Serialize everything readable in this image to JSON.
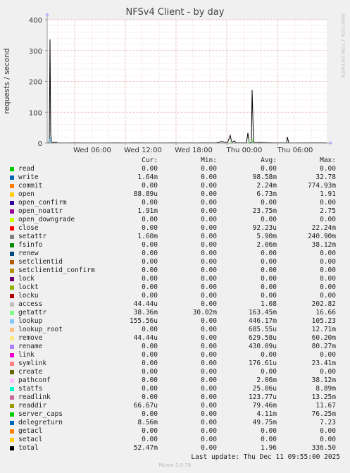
{
  "chart_data": {
    "type": "line",
    "title": "NFSv4 Client - by day",
    "ylabel": "requests / second",
    "ylim": [
      0,
      400
    ],
    "y_ticks": [
      "0",
      "100",
      "200",
      "300",
      "400"
    ],
    "x_ticks": [
      "Wed 06:00",
      "Wed 12:00",
      "Wed 18:00",
      "Thu 00:00",
      "Thu 06:00"
    ],
    "grid": true,
    "series": [
      {
        "name": "total",
        "color": "#000000",
        "points": [
          [
            0,
            0
          ],
          [
            3,
            3
          ],
          [
            4,
            336
          ],
          [
            5,
            30
          ],
          [
            6,
            2
          ],
          [
            12,
            3
          ],
          [
            15,
            1
          ],
          [
            25,
            0.5
          ],
          [
            40,
            1
          ],
          [
            55,
            0.8
          ],
          [
            60,
            0.5
          ],
          [
            80,
            0.4
          ],
          [
            100,
            1
          ],
          [
            110,
            0.6
          ],
          [
            118,
            0.4
          ],
          [
            119,
            1
          ],
          [
            130,
            1
          ],
          [
            145,
            0.6
          ],
          [
            165,
            0.6
          ],
          [
            178,
            1
          ],
          [
            190,
            0.5
          ],
          [
            205,
            1
          ],
          [
            210,
            0.8
          ],
          [
            220,
            1
          ],
          [
            240,
            1
          ],
          [
            248,
            5
          ],
          [
            256,
            1
          ],
          [
            260,
            25
          ],
          [
            262,
            2
          ],
          [
            266,
            7
          ],
          [
            268,
            1
          ],
          [
            283,
            1
          ],
          [
            285,
            33
          ],
          [
            287,
            1
          ],
          [
            290,
            3
          ],
          [
            291,
            172
          ],
          [
            293,
            5
          ],
          [
            295,
            1
          ],
          [
            300,
            2
          ],
          [
            320,
            1
          ],
          [
            340,
            1
          ],
          [
            341,
            20
          ],
          [
            343,
            1
          ],
          [
            350,
            0.5
          ],
          [
            370,
            1
          ],
          [
            396,
            1
          ],
          [
            397,
            0
          ]
        ]
      },
      {
        "name": "getattr",
        "color": "#98FB98",
        "points": [
          [
            0,
            0
          ],
          [
            3,
            0
          ],
          [
            4,
            12
          ],
          [
            6,
            0
          ],
          [
            260,
            0
          ],
          [
            261,
            6
          ],
          [
            262,
            0
          ],
          [
            285,
            0
          ],
          [
            286,
            8
          ],
          [
            287,
            0
          ],
          [
            290,
            0
          ],
          [
            291,
            15
          ],
          [
            293,
            0
          ],
          [
            340,
            0
          ],
          [
            341,
            3
          ],
          [
            343,
            0
          ],
          [
            397,
            0
          ]
        ]
      },
      {
        "name": "readdir",
        "color": "#8B9A0A",
        "points": [
          [
            0,
            0
          ],
          [
            3,
            0
          ],
          [
            4,
            11
          ],
          [
            6,
            0
          ],
          [
            290,
            0
          ],
          [
            291,
            6
          ],
          [
            293,
            0
          ],
          [
            397,
            0
          ]
        ]
      },
      {
        "name": "lookup",
        "color": "#7EC8FF",
        "points": [
          [
            0,
            0
          ],
          [
            3,
            0
          ],
          [
            4,
            20
          ],
          [
            5,
            0
          ],
          [
            290,
            0
          ],
          [
            291,
            4
          ],
          [
            292,
            0
          ],
          [
            397,
            0
          ]
        ]
      }
    ]
  },
  "legend": {
    "headers": {
      "cur": "Cur:",
      "min": "Min:",
      "avg": "Avg:",
      "max": "Max:"
    },
    "rows": [
      {
        "name": "read",
        "color": "#00CC00",
        "cur": "0.00",
        "min": "0.00",
        "avg": "0.00",
        "max": "0.00"
      },
      {
        "name": "write",
        "color": "#0066B3",
        "cur": "1.64m",
        "min": "0.00",
        "avg": "98.58m",
        "max": "32.78"
      },
      {
        "name": "commit",
        "color": "#FF8000",
        "cur": "0.00",
        "min": "0.00",
        "avg": "2.24m",
        "max": "774.93m"
      },
      {
        "name": "open",
        "color": "#FFCC00",
        "cur": "88.89u",
        "min": "0.00",
        "avg": "6.73m",
        "max": "1.91"
      },
      {
        "name": "open_confirm",
        "color": "#330099",
        "cur": "0.00",
        "min": "0.00",
        "avg": "0.00",
        "max": "0.00"
      },
      {
        "name": "open_noattr",
        "color": "#990099",
        "cur": "1.91m",
        "min": "0.00",
        "avg": "23.75m",
        "max": "2.75"
      },
      {
        "name": "open_downgrade",
        "color": "#CCFF00",
        "cur": "0.00",
        "min": "0.00",
        "avg": "0.00",
        "max": "0.00"
      },
      {
        "name": "close",
        "color": "#FF0000",
        "cur": "0.00",
        "min": "0.00",
        "avg": "92.23u",
        "max": "22.24m"
      },
      {
        "name": "setattr",
        "color": "#808080",
        "cur": "1.60m",
        "min": "0.00",
        "avg": "5.90m",
        "max": "240.90m"
      },
      {
        "name": "fsinfo",
        "color": "#008F00",
        "cur": "0.00",
        "min": "0.00",
        "avg": "2.06m",
        "max": "38.12m"
      },
      {
        "name": "renew",
        "color": "#00487D",
        "cur": "0.00",
        "min": "0.00",
        "avg": "0.00",
        "max": "0.00"
      },
      {
        "name": "setclientid",
        "color": "#B35A00",
        "cur": "0.00",
        "min": "0.00",
        "avg": "0.00",
        "max": "0.00"
      },
      {
        "name": "setclientid_confirm",
        "color": "#B38F00",
        "cur": "0.00",
        "min": "0.00",
        "avg": "0.00",
        "max": "0.00"
      },
      {
        "name": "lock",
        "color": "#6B006B",
        "cur": "0.00",
        "min": "0.00",
        "avg": "0.00",
        "max": "0.00"
      },
      {
        "name": "lockt",
        "color": "#8FB300",
        "cur": "0.00",
        "min": "0.00",
        "avg": "0.00",
        "max": "0.00"
      },
      {
        "name": "locku",
        "color": "#B30000",
        "cur": "0.00",
        "min": "0.00",
        "avg": "0.00",
        "max": "0.00"
      },
      {
        "name": "access",
        "color": "#BEBEBE",
        "cur": "44.44u",
        "min": "0.00",
        "avg": "1.08",
        "max": "202.82"
      },
      {
        "name": "getattr",
        "color": "#80FF80",
        "cur": "38.36m",
        "min": "30.02m",
        "avg": "163.45m",
        "max": "16.66"
      },
      {
        "name": "lookup",
        "color": "#80C9FF",
        "cur": "155.56u",
        "min": "0.00",
        "avg": "446.17m",
        "max": "105.23"
      },
      {
        "name": "lookup_root",
        "color": "#FFC080",
        "cur": "0.00",
        "min": "0.00",
        "avg": "685.55u",
        "max": "12.71m"
      },
      {
        "name": "remove",
        "color": "#FFE680",
        "cur": "44.44u",
        "min": "0.00",
        "avg": "629.58u",
        "max": "60.20m"
      },
      {
        "name": "rename",
        "color": "#AA80FF",
        "cur": "0.00",
        "min": "0.00",
        "avg": "430.09u",
        "max": "80.27m"
      },
      {
        "name": "link",
        "color": "#EE00CC",
        "cur": "0.00",
        "min": "0.00",
        "avg": "0.00",
        "max": "0.00"
      },
      {
        "name": "symlink",
        "color": "#FF8080",
        "cur": "0.00",
        "min": "0.00",
        "avg": "176.61u",
        "max": "23.41m"
      },
      {
        "name": "create",
        "color": "#666600",
        "cur": "0.00",
        "min": "0.00",
        "avg": "0.00",
        "max": "0.00"
      },
      {
        "name": "pathconf",
        "color": "#FFBFFF",
        "cur": "0.00",
        "min": "0.00",
        "avg": "2.06m",
        "max": "38.12m"
      },
      {
        "name": "statfs",
        "color": "#00FFCC",
        "cur": "0.00",
        "min": "0.00",
        "avg": "25.06u",
        "max": "8.89m"
      },
      {
        "name": "readlink",
        "color": "#CC6699",
        "cur": "0.00",
        "min": "0.00",
        "avg": "123.77u",
        "max": "13.25m"
      },
      {
        "name": "readdir",
        "color": "#999900",
        "cur": "66.67u",
        "min": "0.00",
        "avg": "79.46m",
        "max": "11.67"
      },
      {
        "name": "server_caps",
        "color": "#00CC00",
        "cur": "0.00",
        "min": "0.00",
        "avg": "4.11m",
        "max": "76.25m"
      },
      {
        "name": "delegreturn",
        "color": "#0066B3",
        "cur": "8.56m",
        "min": "0.00",
        "avg": "49.75m",
        "max": "7.23"
      },
      {
        "name": "getacl",
        "color": "#FF8000",
        "cur": "0.00",
        "min": "0.00",
        "avg": "0.00",
        "max": "0.00"
      },
      {
        "name": "setacl",
        "color": "#FFCC00",
        "cur": "0.00",
        "min": "0.00",
        "avg": "0.00",
        "max": "0.00"
      },
      {
        "name": "total",
        "color": "#000000",
        "cur": "52.47m",
        "min": "0.00",
        "avg": "1.96",
        "max": "336.50"
      }
    ]
  },
  "last_update": "Last update: Thu Dec 11 09:55:00 2025",
  "watermark": "RRDTOOL / TOBI OETIKER",
  "footer": "Munin 2.0.76"
}
